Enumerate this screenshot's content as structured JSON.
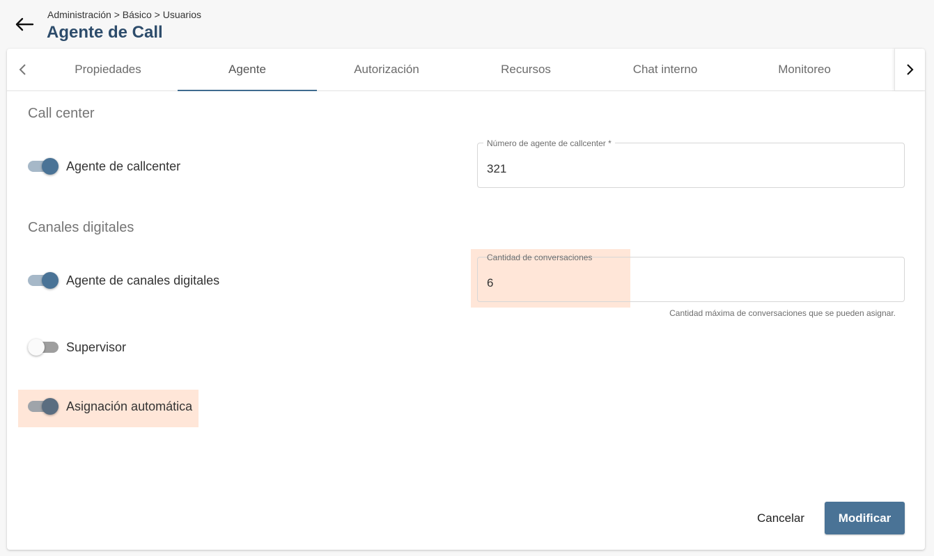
{
  "header": {
    "breadcrumb": "Administración > Básico > Usuarios",
    "title": "Agente de Call",
    "back_icon": "arrow-left-icon"
  },
  "tabs": [
    {
      "label": "Propiedades",
      "active": false
    },
    {
      "label": "Agente",
      "active": true
    },
    {
      "label": "Autorización",
      "active": false
    },
    {
      "label": "Recursos",
      "active": false
    },
    {
      "label": "Chat interno",
      "active": false
    },
    {
      "label": "Monitoreo",
      "active": false
    }
  ],
  "tab_nav": {
    "prev_icon": "chevron-left-icon",
    "next_icon": "chevron-right-icon"
  },
  "sections": {
    "call_center": "Call center",
    "digital": "Canales digitales"
  },
  "toggles": {
    "callcenter_agent": {
      "label": "Agente de callcenter",
      "on": true
    },
    "digital_agent": {
      "label": "Agente de canales digitales",
      "on": true
    },
    "supervisor": {
      "label": "Supervisor",
      "on": false
    },
    "auto_assign": {
      "label": "Asignación automática",
      "on": true
    }
  },
  "fields": {
    "agent_number": {
      "label": "Número de agente de callcenter *",
      "value": "321"
    },
    "conversations": {
      "label": "Cantidad de conversaciones",
      "value": "6",
      "hint": "Cantidad máxima de conversaciones que se pueden asignar."
    }
  },
  "actions": {
    "cancel": "Cancelar",
    "submit": "Modificar"
  },
  "colors": {
    "accent": "#4a7396",
    "title": "#2d4c6b",
    "highlight": "#ffd5be"
  }
}
